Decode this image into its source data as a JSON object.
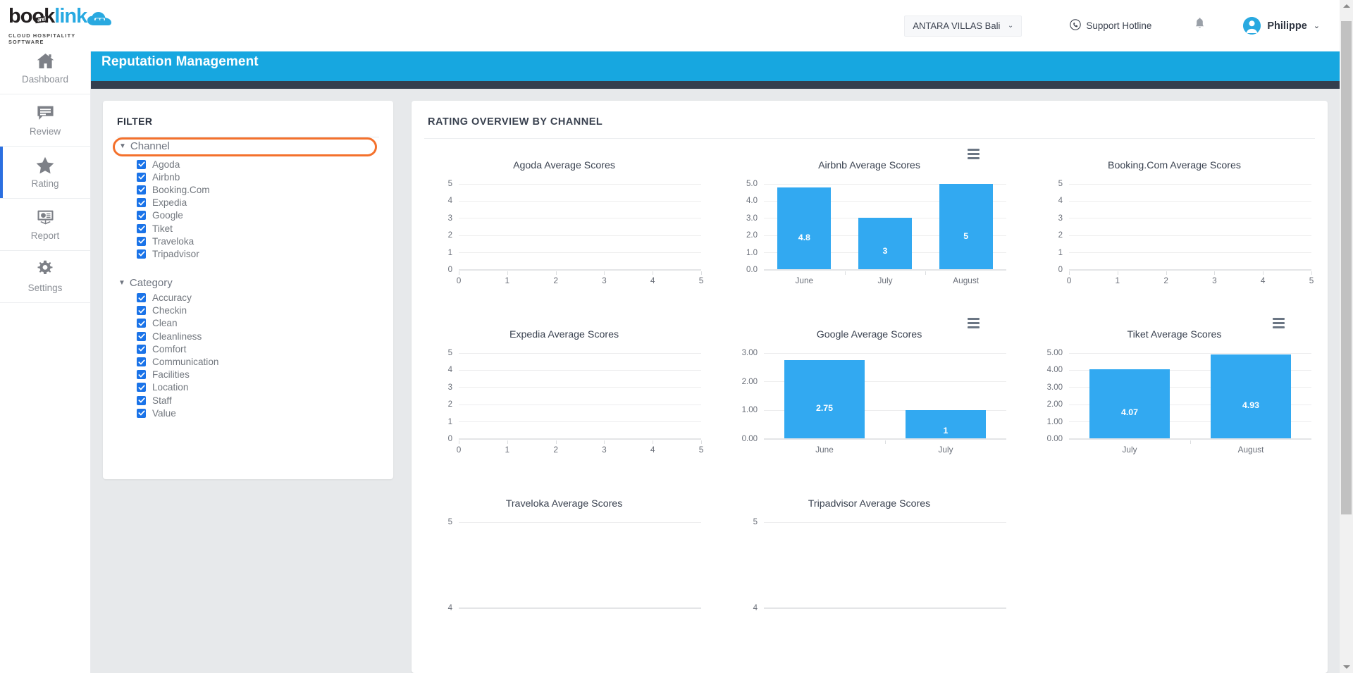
{
  "topbar": {
    "logo": {
      "text_book": "book",
      "text_link": "link",
      "badge": "and",
      "tagline": "CLOUD HOSPITALITY SOFTWARE"
    },
    "property_select": {
      "value": "ANTARA VILLAS Bali",
      "chevron": "⌄"
    },
    "support_label": "Support Hotline",
    "user_name": "Philippe",
    "user_chevron": "⌄"
  },
  "sidebar": {
    "items": [
      {
        "label": "Dashboard",
        "icon": "home-icon",
        "active": false
      },
      {
        "label": "Review",
        "icon": "comment-icon",
        "active": false
      },
      {
        "label": "Rating",
        "icon": "star-icon",
        "active": true
      },
      {
        "label": "Report",
        "icon": "presentation-chart-icon",
        "active": false
      },
      {
        "label": "Settings",
        "icon": "gear-icon",
        "active": false
      }
    ]
  },
  "banner": {
    "title": "Reputation Management"
  },
  "filter": {
    "title": "FILTER",
    "groups": [
      {
        "name": "Channel",
        "caret": "▼",
        "highlighted": true,
        "options": [
          {
            "label": "Agoda",
            "checked": true
          },
          {
            "label": "Airbnb",
            "checked": true
          },
          {
            "label": "Booking.Com",
            "checked": true
          },
          {
            "label": "Expedia",
            "checked": true
          },
          {
            "label": "Google",
            "checked": true
          },
          {
            "label": "Tiket",
            "checked": true
          },
          {
            "label": "Traveloka",
            "checked": true
          },
          {
            "label": "Tripadvisor",
            "checked": true
          }
        ]
      },
      {
        "name": "Category",
        "caret": "▼",
        "highlighted": false,
        "options": [
          {
            "label": "Accuracy",
            "checked": true
          },
          {
            "label": "Checkin",
            "checked": true
          },
          {
            "label": "Clean",
            "checked": true
          },
          {
            "label": "Cleanliness",
            "checked": true
          },
          {
            "label": "Comfort",
            "checked": true
          },
          {
            "label": "Communication",
            "checked": true
          },
          {
            "label": "Facilities",
            "checked": true
          },
          {
            "label": "Location",
            "checked": true
          },
          {
            "label": "Staff",
            "checked": true
          },
          {
            "label": "Value",
            "checked": true
          }
        ]
      }
    ]
  },
  "main": {
    "section_title": "RATING OVERVIEW BY CHANNEL",
    "bar_color": "#32a9f1",
    "accent_color": "#17a7e0",
    "highlight_color": "#f4712c"
  },
  "chart_data": [
    {
      "type": "bar",
      "title": "Agoda Average Scores",
      "categories": [],
      "values": [],
      "empty": true,
      "xlabel": "",
      "ylabel": "",
      "yticks": [
        "5",
        "4",
        "3",
        "2",
        "1",
        "0"
      ],
      "ylim": [
        0,
        5
      ],
      "xticks": [
        "0",
        "1",
        "2",
        "3",
        "4",
        "5"
      ],
      "xlim": [
        0,
        5
      ],
      "grid": true,
      "has_menu": false
    },
    {
      "type": "bar",
      "title": "Airbnb Average Scores",
      "categories": [
        "June",
        "July",
        "August"
      ],
      "values": [
        4.8,
        3,
        5
      ],
      "labels": [
        "4.8",
        "3",
        "5"
      ],
      "empty": false,
      "xlabel": "",
      "ylabel": "",
      "yticks": [
        "5.0",
        "4.0",
        "3.0",
        "2.0",
        "1.0",
        "0.0"
      ],
      "ylim": [
        0,
        5
      ],
      "grid": true,
      "has_menu": true
    },
    {
      "type": "bar",
      "title": "Booking.Com Average Scores",
      "categories": [],
      "values": [],
      "empty": true,
      "xlabel": "",
      "ylabel": "",
      "yticks": [
        "5",
        "4",
        "3",
        "2",
        "1",
        "0"
      ],
      "ylim": [
        0,
        5
      ],
      "xticks": [
        "0",
        "1",
        "2",
        "3",
        "4",
        "5"
      ],
      "xlim": [
        0,
        5
      ],
      "grid": true,
      "has_menu": false
    },
    {
      "type": "bar",
      "title": "Expedia Average Scores",
      "categories": [],
      "values": [],
      "empty": true,
      "xlabel": "",
      "ylabel": "",
      "yticks": [
        "5",
        "4",
        "3",
        "2",
        "1",
        "0"
      ],
      "ylim": [
        0,
        5
      ],
      "xticks": [
        "0",
        "1",
        "2",
        "3",
        "4",
        "5"
      ],
      "xlim": [
        0,
        5
      ],
      "grid": true,
      "has_menu": false
    },
    {
      "type": "bar",
      "title": "Google Average Scores",
      "categories": [
        "June",
        "July"
      ],
      "values": [
        2.75,
        1
      ],
      "labels": [
        "2.75",
        "1"
      ],
      "empty": false,
      "xlabel": "",
      "ylabel": "",
      "yticks": [
        "3.00",
        "2.00",
        "1.00",
        "0.00"
      ],
      "ylim": [
        0,
        3
      ],
      "grid": true,
      "has_menu": true
    },
    {
      "type": "bar",
      "title": "Tiket Average Scores",
      "categories": [
        "July",
        "August"
      ],
      "values": [
        4.07,
        4.93
      ],
      "labels": [
        "4.07",
        "4.93"
      ],
      "empty": false,
      "xlabel": "",
      "ylabel": "",
      "yticks": [
        "5.00",
        "4.00",
        "3.00",
        "2.00",
        "1.00",
        "0.00"
      ],
      "ylim": [
        0,
        5
      ],
      "grid": true,
      "has_menu": true
    },
    {
      "type": "bar",
      "title": "Traveloka Average Scores",
      "categories": [],
      "values": [],
      "empty": true,
      "xlabel": "",
      "ylabel": "",
      "yticks": [
        "5",
        "4"
      ],
      "ylim": [
        0,
        5
      ],
      "grid": true,
      "has_menu": false,
      "clipped": true
    },
    {
      "type": "bar",
      "title": "Tripadvisor Average Scores",
      "categories": [],
      "values": [],
      "empty": true,
      "xlabel": "",
      "ylabel": "",
      "yticks": [
        "5",
        "4"
      ],
      "ylim": [
        0,
        5
      ],
      "grid": true,
      "has_menu": false,
      "clipped": true
    }
  ]
}
